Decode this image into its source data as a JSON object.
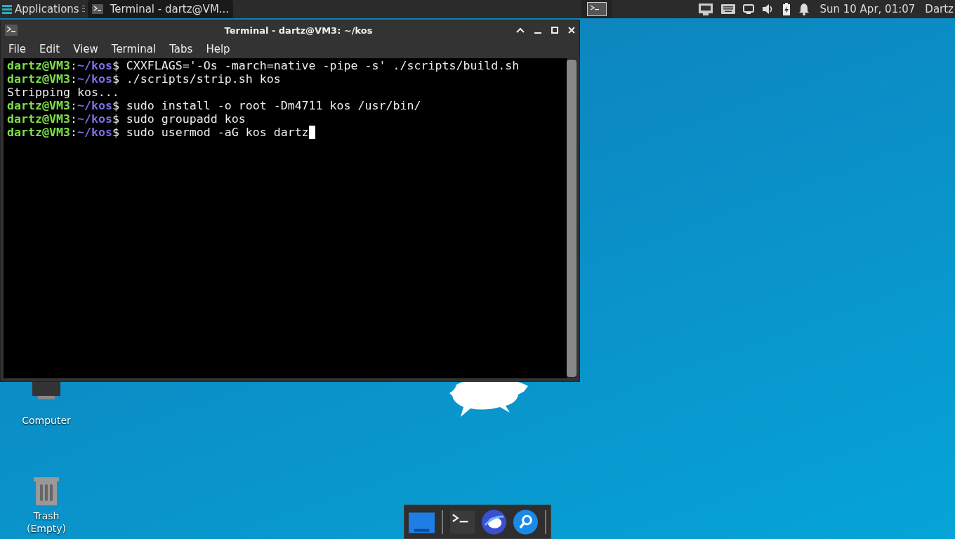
{
  "panel": {
    "menu_label": "Applications",
    "tasks": [
      {
        "title": "Terminal - dartz@VM...",
        "selected": true
      }
    ],
    "clock": "Sun 10 Apr, 01:07",
    "user": "Dartz"
  },
  "window": {
    "title": "Terminal - dartz@VM3: ~/kos",
    "menu": [
      "File",
      "Edit",
      "View",
      "Terminal",
      "Tabs",
      "Help"
    ],
    "lines": [
      {
        "kind": "prompt",
        "user": "dartz@VM3",
        "sep": ":",
        "path": "~/kos",
        "sign": "$",
        "command": " CXXFLAGS='-Os -march=native -pipe -s' ./scripts/build.sh",
        "cursor": false
      },
      {
        "kind": "prompt",
        "user": "dartz@VM3",
        "sep": ":",
        "path": "~/kos",
        "sign": "$",
        "command": " ./scripts/strip.sh kos",
        "cursor": false
      },
      {
        "kind": "output",
        "text": "Stripping kos..."
      },
      {
        "kind": "prompt",
        "user": "dartz@VM3",
        "sep": ":",
        "path": "~/kos",
        "sign": "$",
        "command": " sudo install -o root -Dm4711 kos /usr/bin/",
        "cursor": false
      },
      {
        "kind": "prompt",
        "user": "dartz@VM3",
        "sep": ":",
        "path": "~/kos",
        "sign": "$",
        "command": " sudo groupadd kos",
        "cursor": false
      },
      {
        "kind": "prompt",
        "user": "dartz@VM3",
        "sep": ":",
        "path": "~/kos",
        "sign": "$",
        "command": " sudo usermod -aG kos dartz",
        "cursor": true
      }
    ]
  },
  "desktop_icons": [
    {
      "kind": "computer",
      "label": "Computer"
    },
    {
      "kind": "trash",
      "label": "Trash\n(Empty)"
    }
  ]
}
